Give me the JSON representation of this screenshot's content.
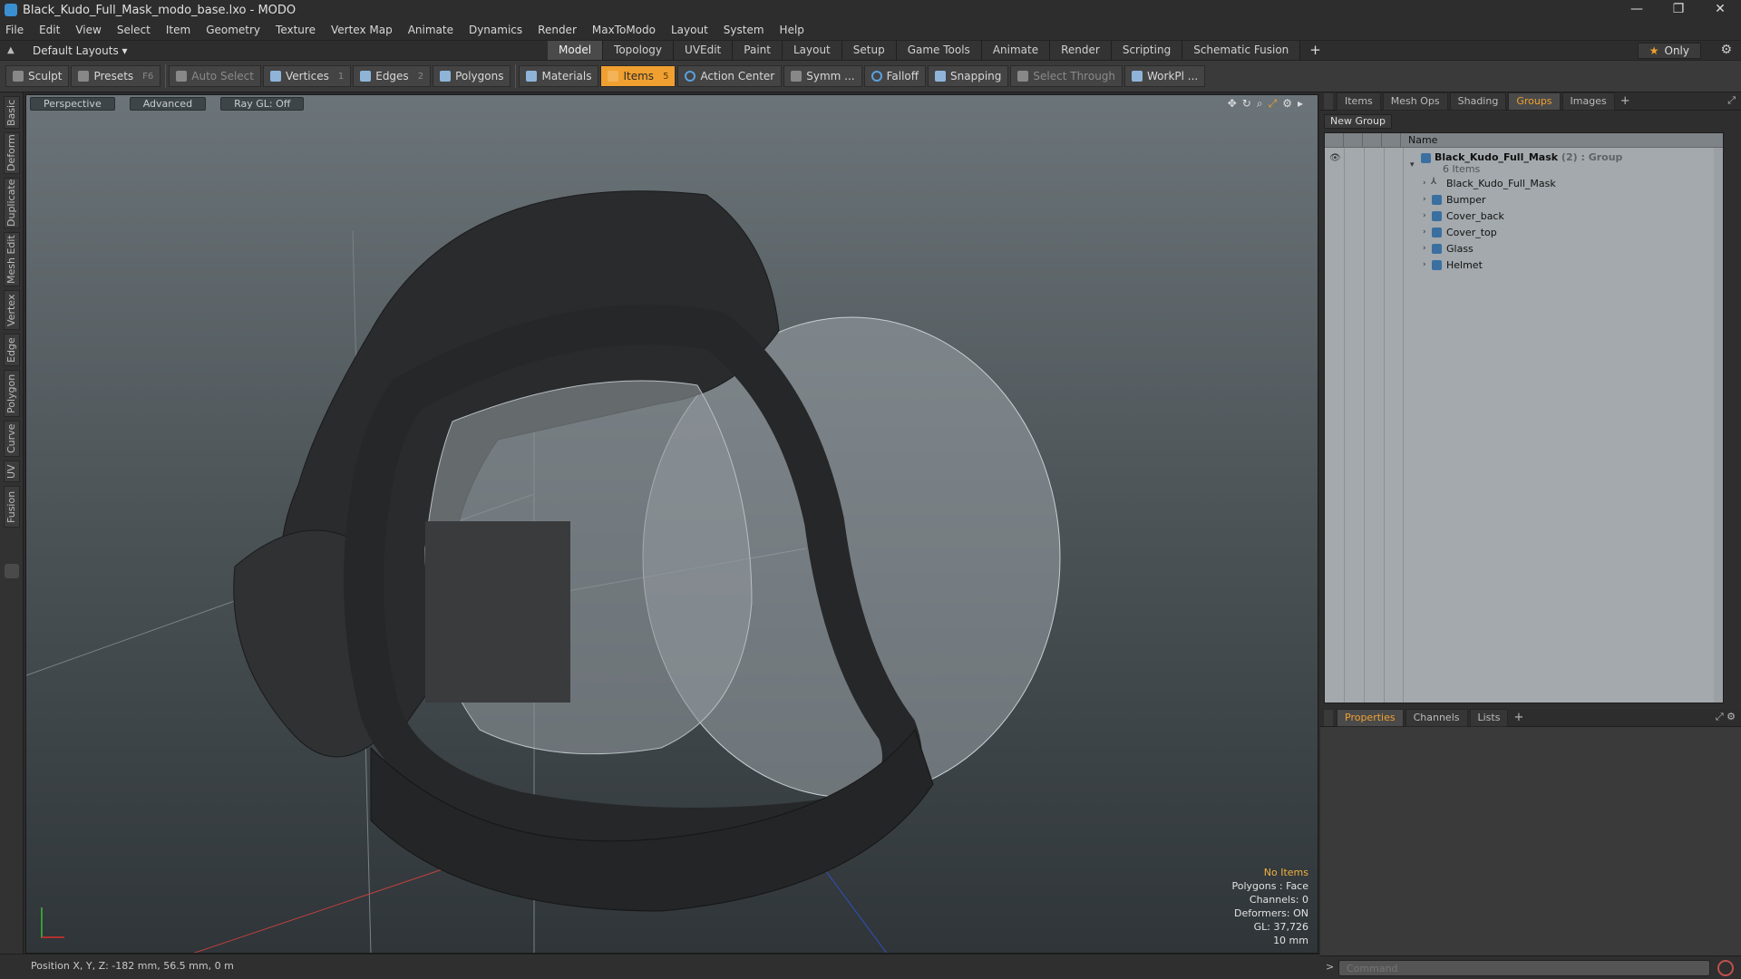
{
  "window": {
    "title": "Black_Kudo_Full_Mask_modo_base.lxo - MODO",
    "minimize": "—",
    "restore": "❐",
    "close": "✕"
  },
  "menu": [
    "File",
    "Edit",
    "View",
    "Select",
    "Item",
    "Geometry",
    "Texture",
    "Vertex Map",
    "Animate",
    "Dynamics",
    "Render",
    "MaxToModo",
    "Layout",
    "System",
    "Help"
  ],
  "layout_select": "Default Layouts ▾",
  "tabs": [
    {
      "label": "Model",
      "active": true
    },
    {
      "label": "Topology"
    },
    {
      "label": "UVEdit"
    },
    {
      "label": "Paint"
    },
    {
      "label": "Layout"
    },
    {
      "label": "Setup"
    },
    {
      "label": "Game Tools"
    },
    {
      "label": "Animate"
    },
    {
      "label": "Render"
    },
    {
      "label": "Scripting"
    },
    {
      "label": "Schematic Fusion"
    }
  ],
  "tab_add": "+",
  "only_label": "Only",
  "toolbar": {
    "sculpt": "Sculpt",
    "presets": "Presets",
    "presets_key": "F6",
    "auto_select": "Auto Select",
    "vertices": "Vertices",
    "vertices_key": "1",
    "edges": "Edges",
    "edges_key": "2",
    "polygons": "Polygons",
    "materials": "Materials",
    "items": "Items",
    "action_center": "Action Center",
    "symmetry": "Symm ...",
    "falloff": "Falloff",
    "snapping": "Snapping",
    "select_through": "Select Through",
    "workplane": "WorkPl ..."
  },
  "left_tabs": [
    "Basic",
    "Deform",
    "Duplicate",
    "Mesh Edit",
    "Vertex",
    "Edge",
    "Polygon",
    "Curve",
    "UV",
    "Fusion"
  ],
  "viewport": {
    "view_mode": "Perspective",
    "shading": "Advanced",
    "raygl": "Ray GL: Off",
    "info": {
      "no_items": "No Items",
      "polygons": "Polygons : Face",
      "channels": "Channels: 0",
      "deformers": "Deformers: ON",
      "gl": "GL: 37,726",
      "scale": "10 mm"
    }
  },
  "status": {
    "position": "Position X, Y, Z:  -182 mm, 56.5 mm, 0 m"
  },
  "right_tabs": [
    {
      "label": "Items"
    },
    {
      "label": "Mesh Ops"
    },
    {
      "label": "Shading"
    },
    {
      "label": "Groups",
      "active": true
    },
    {
      "label": "Images"
    }
  ],
  "groups": {
    "new_group": "New Group",
    "column_name": "Name",
    "root": {
      "name": "Black_Kudo_Full_Mask",
      "meta": "(2) : Group",
      "count": "6 Items"
    },
    "children": [
      "Black_Kudo_Full_Mask",
      "Bumper",
      "Cover_back",
      "Cover_top",
      "Glass",
      "Helmet"
    ]
  },
  "props_tabs": [
    {
      "label": "Properties",
      "active": true
    },
    {
      "label": "Channels"
    },
    {
      "label": "Lists"
    }
  ],
  "command": {
    "placeholder": "Command"
  },
  "colors": {
    "accent": "#f0a030",
    "viewport_top": "#6b7478",
    "viewport_bottom": "#2f3538"
  }
}
